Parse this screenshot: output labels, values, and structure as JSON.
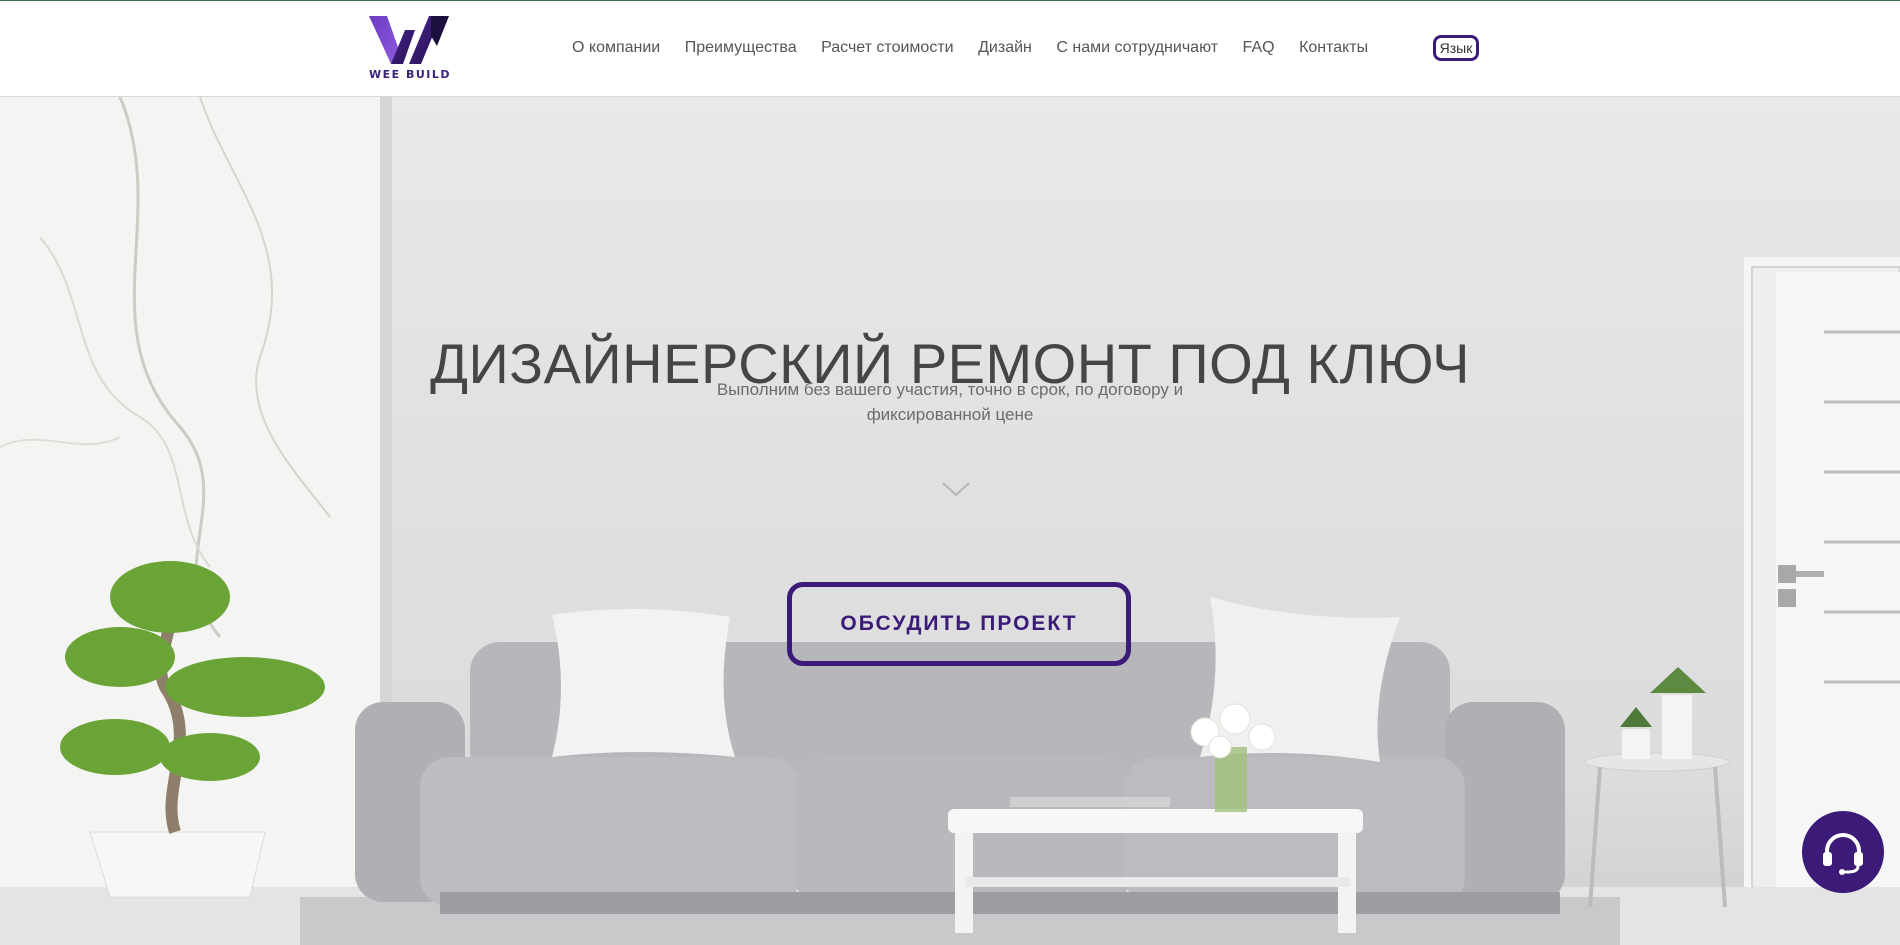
{
  "brand": {
    "logo_text": "WEE BUILD",
    "accent_color": "#3b1a78"
  },
  "nav": {
    "items": [
      "О компании",
      "Преимущества",
      "Расчет стоимости",
      "Дизайн",
      "С нами сотрудничают",
      "FAQ",
      "Контакты"
    ],
    "language_label": "Язык"
  },
  "hero": {
    "title": "ДИЗАЙНЕРСКИЙ РЕМОНТ ПОД КЛЮЧ",
    "subtitle": "Выполним без вашего участия, точно в срок, по договору и фиксированной цене",
    "cta_label": "ОБСУДИТЬ ПРОЕКТ",
    "scroll_icon": "chevron-down-icon"
  },
  "support_widget": {
    "icon": "headset-icon"
  }
}
